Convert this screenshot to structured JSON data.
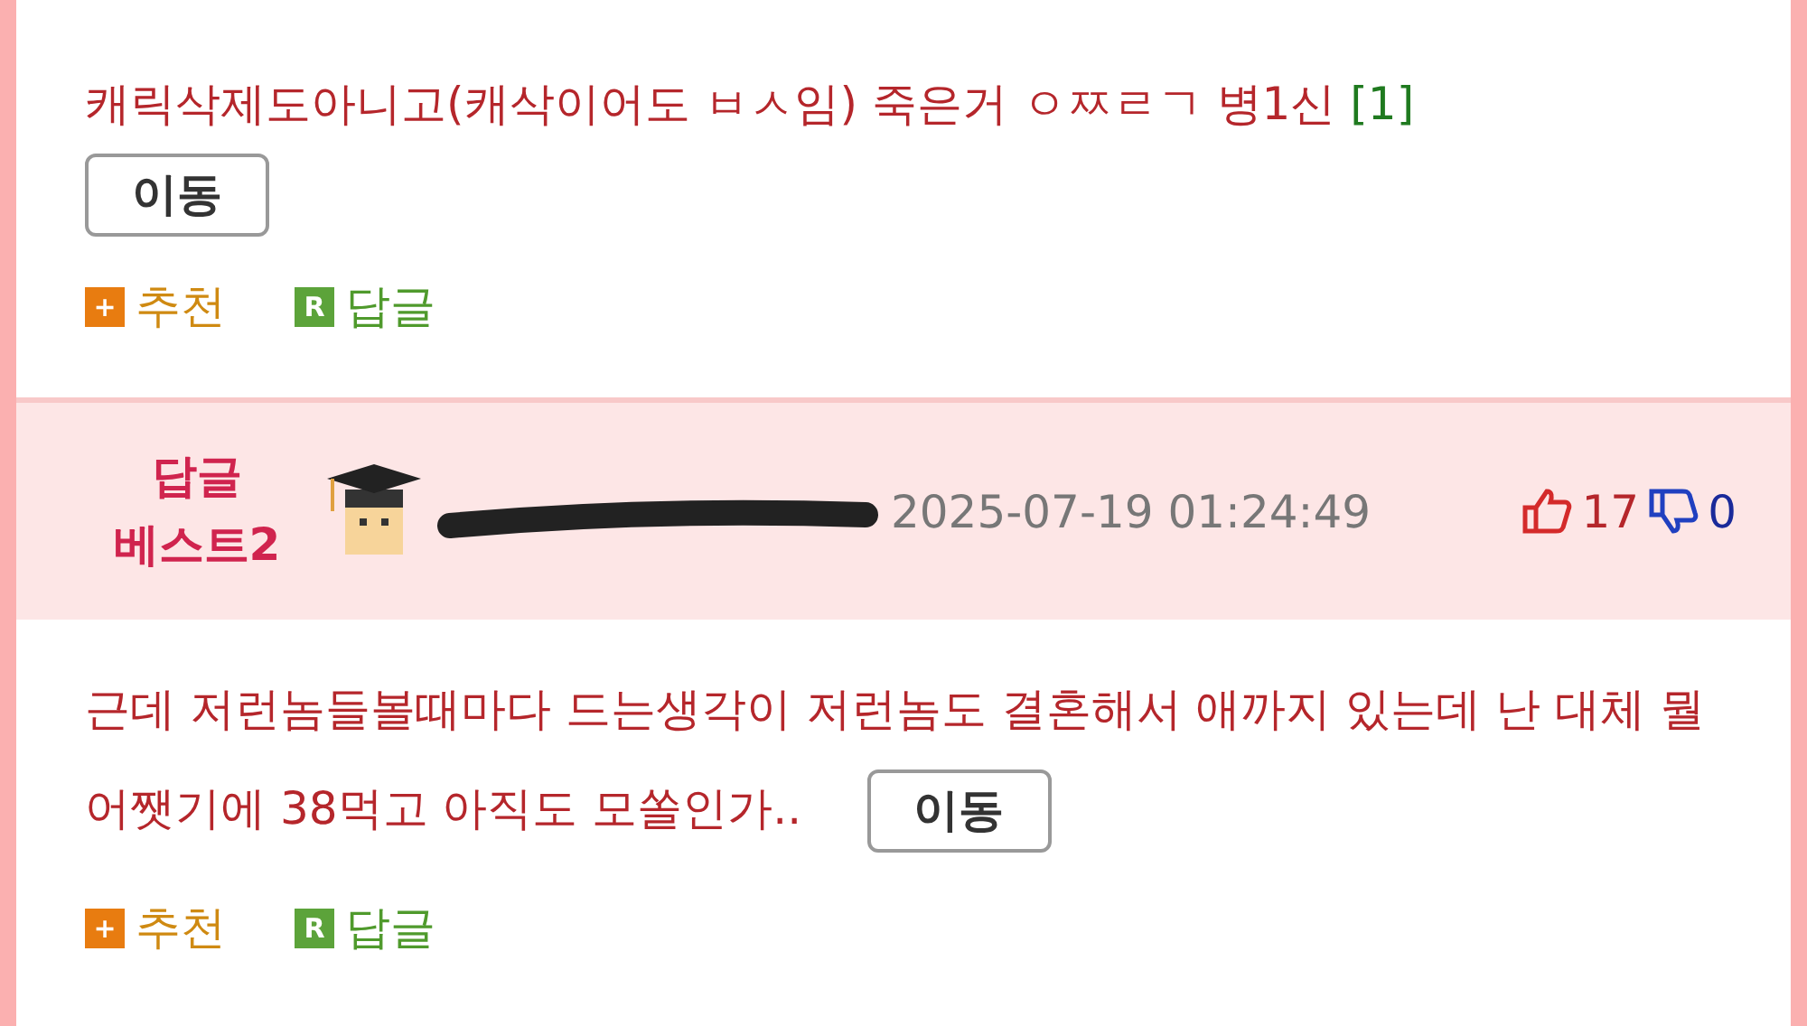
{
  "comments": [
    {
      "text": "캐릭삭제도아니고(캐삭이어도 ㅂㅅ임) 죽은거 ㅇㅉㄹㄱ 병1신",
      "reply_count": "[1]",
      "move_button": "이동",
      "move_inline": false,
      "actions": [
        {
          "kind": "recommend",
          "icon": "+",
          "label": "추천"
        },
        {
          "kind": "reply",
          "icon": "R",
          "label": "답글"
        }
      ]
    },
    {
      "header": {
        "best_label": [
          "답글",
          "베스트2"
        ],
        "date": "2025-07-19 01:24:49",
        "likes": "17",
        "dislikes": "0"
      },
      "text": "근데 저런놈들볼때마다 드는생각이 저런놈도 결혼해서 애까지 있는데 난 대체 뭘 어쨋기에 38먹고 아직도 모쏠인가..",
      "move_button": "이동",
      "move_inline": true,
      "actions": [
        {
          "kind": "recommend",
          "icon": "+",
          "label": "추천"
        },
        {
          "kind": "reply",
          "icon": "R",
          "label": "답글"
        }
      ]
    }
  ]
}
